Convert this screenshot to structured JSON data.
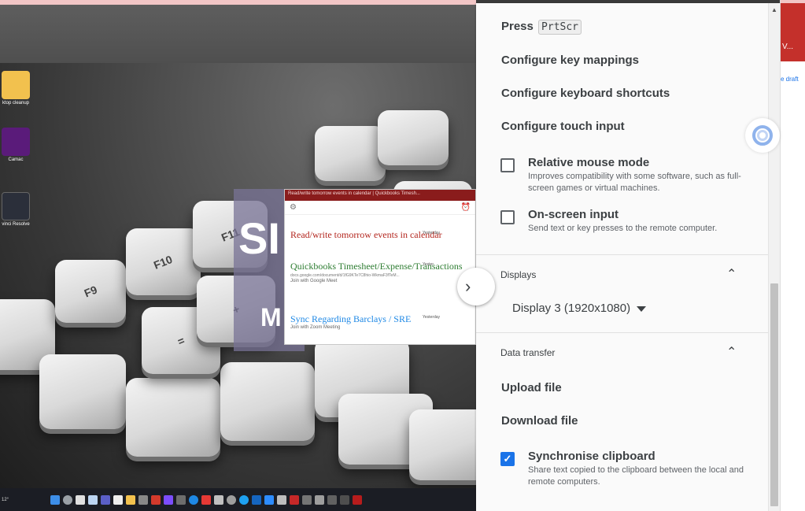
{
  "remote_desktop": {
    "desktop_icons": [
      {
        "label": "ktop cleanup",
        "icon": "folder-icon",
        "color": "#f2c14e"
      },
      {
        "label": "Camac",
        "icon": "camac-app-icon",
        "color": "#5a1b7a"
      },
      {
        "label": "vinci Resolve",
        "icon": "davinci-resolve-icon",
        "color": "#2b2f3a"
      }
    ],
    "keyboard_keys": [
      "F11",
      "F10",
      "F9",
      "+",
      "="
    ],
    "slide_text": {
      "big": "SI",
      "medium": "M"
    },
    "calendar": {
      "title": "Read/write tomorrow events in calendar | Quickbooks Timesh...",
      "events": [
        {
          "name": "Read/write tomorrow events in calendar",
          "time": "Yesterday",
          "color": "#b3261e",
          "sub": "",
          "meet": ""
        },
        {
          "name": "Quickbooks Timesheet/Expense/Transactions",
          "time": "Yester",
          "color": "#2e7d32",
          "sub": "docs.google.com/document/d/1fG9KTe7C8hio-WkmaF3fTeM...",
          "meet": "Join with Google Meet"
        },
        {
          "name": "Sync Regarding Barclays / SRE",
          "time": "Yesterday",
          "color": "#1e88e5",
          "sub": "",
          "meet": "Join with Zoom Meeting"
        }
      ]
    },
    "taskbar": {
      "weather": "12°"
    },
    "expand_icon": "chevron-right-icon"
  },
  "panel": {
    "press_label": "Press",
    "press_key": "PrtScr",
    "menu": {
      "key_mappings": "Configure key mappings",
      "keyboard_shortcuts": "Configure keyboard shortcuts",
      "touch_input": "Configure touch input"
    },
    "options": {
      "relative_mouse": {
        "label": "Relative mouse mode",
        "description": "Improves compatibility with some software, such as full-screen games or virtual machines.",
        "checked": false
      },
      "onscreen_input": {
        "label": "On-screen input",
        "description": "Send text or key presses to the remote computer.",
        "checked": false
      }
    },
    "displays": {
      "header": "Displays",
      "selected": "Display 3 (1920x1080)"
    },
    "data_transfer": {
      "header": "Data transfer",
      "upload": "Upload file",
      "download": "Download file",
      "sync": {
        "label": "Synchronise clipboard",
        "description": "Share text copied to the clipboard between the local and remote computers.",
        "checked": true
      }
    }
  },
  "browser_strip": {
    "tab_label": "V...",
    "draft_label": "e draft"
  },
  "colors": {
    "accent": "#1a73e8",
    "text": "#3c4043",
    "secondary_text": "#5f6368"
  }
}
